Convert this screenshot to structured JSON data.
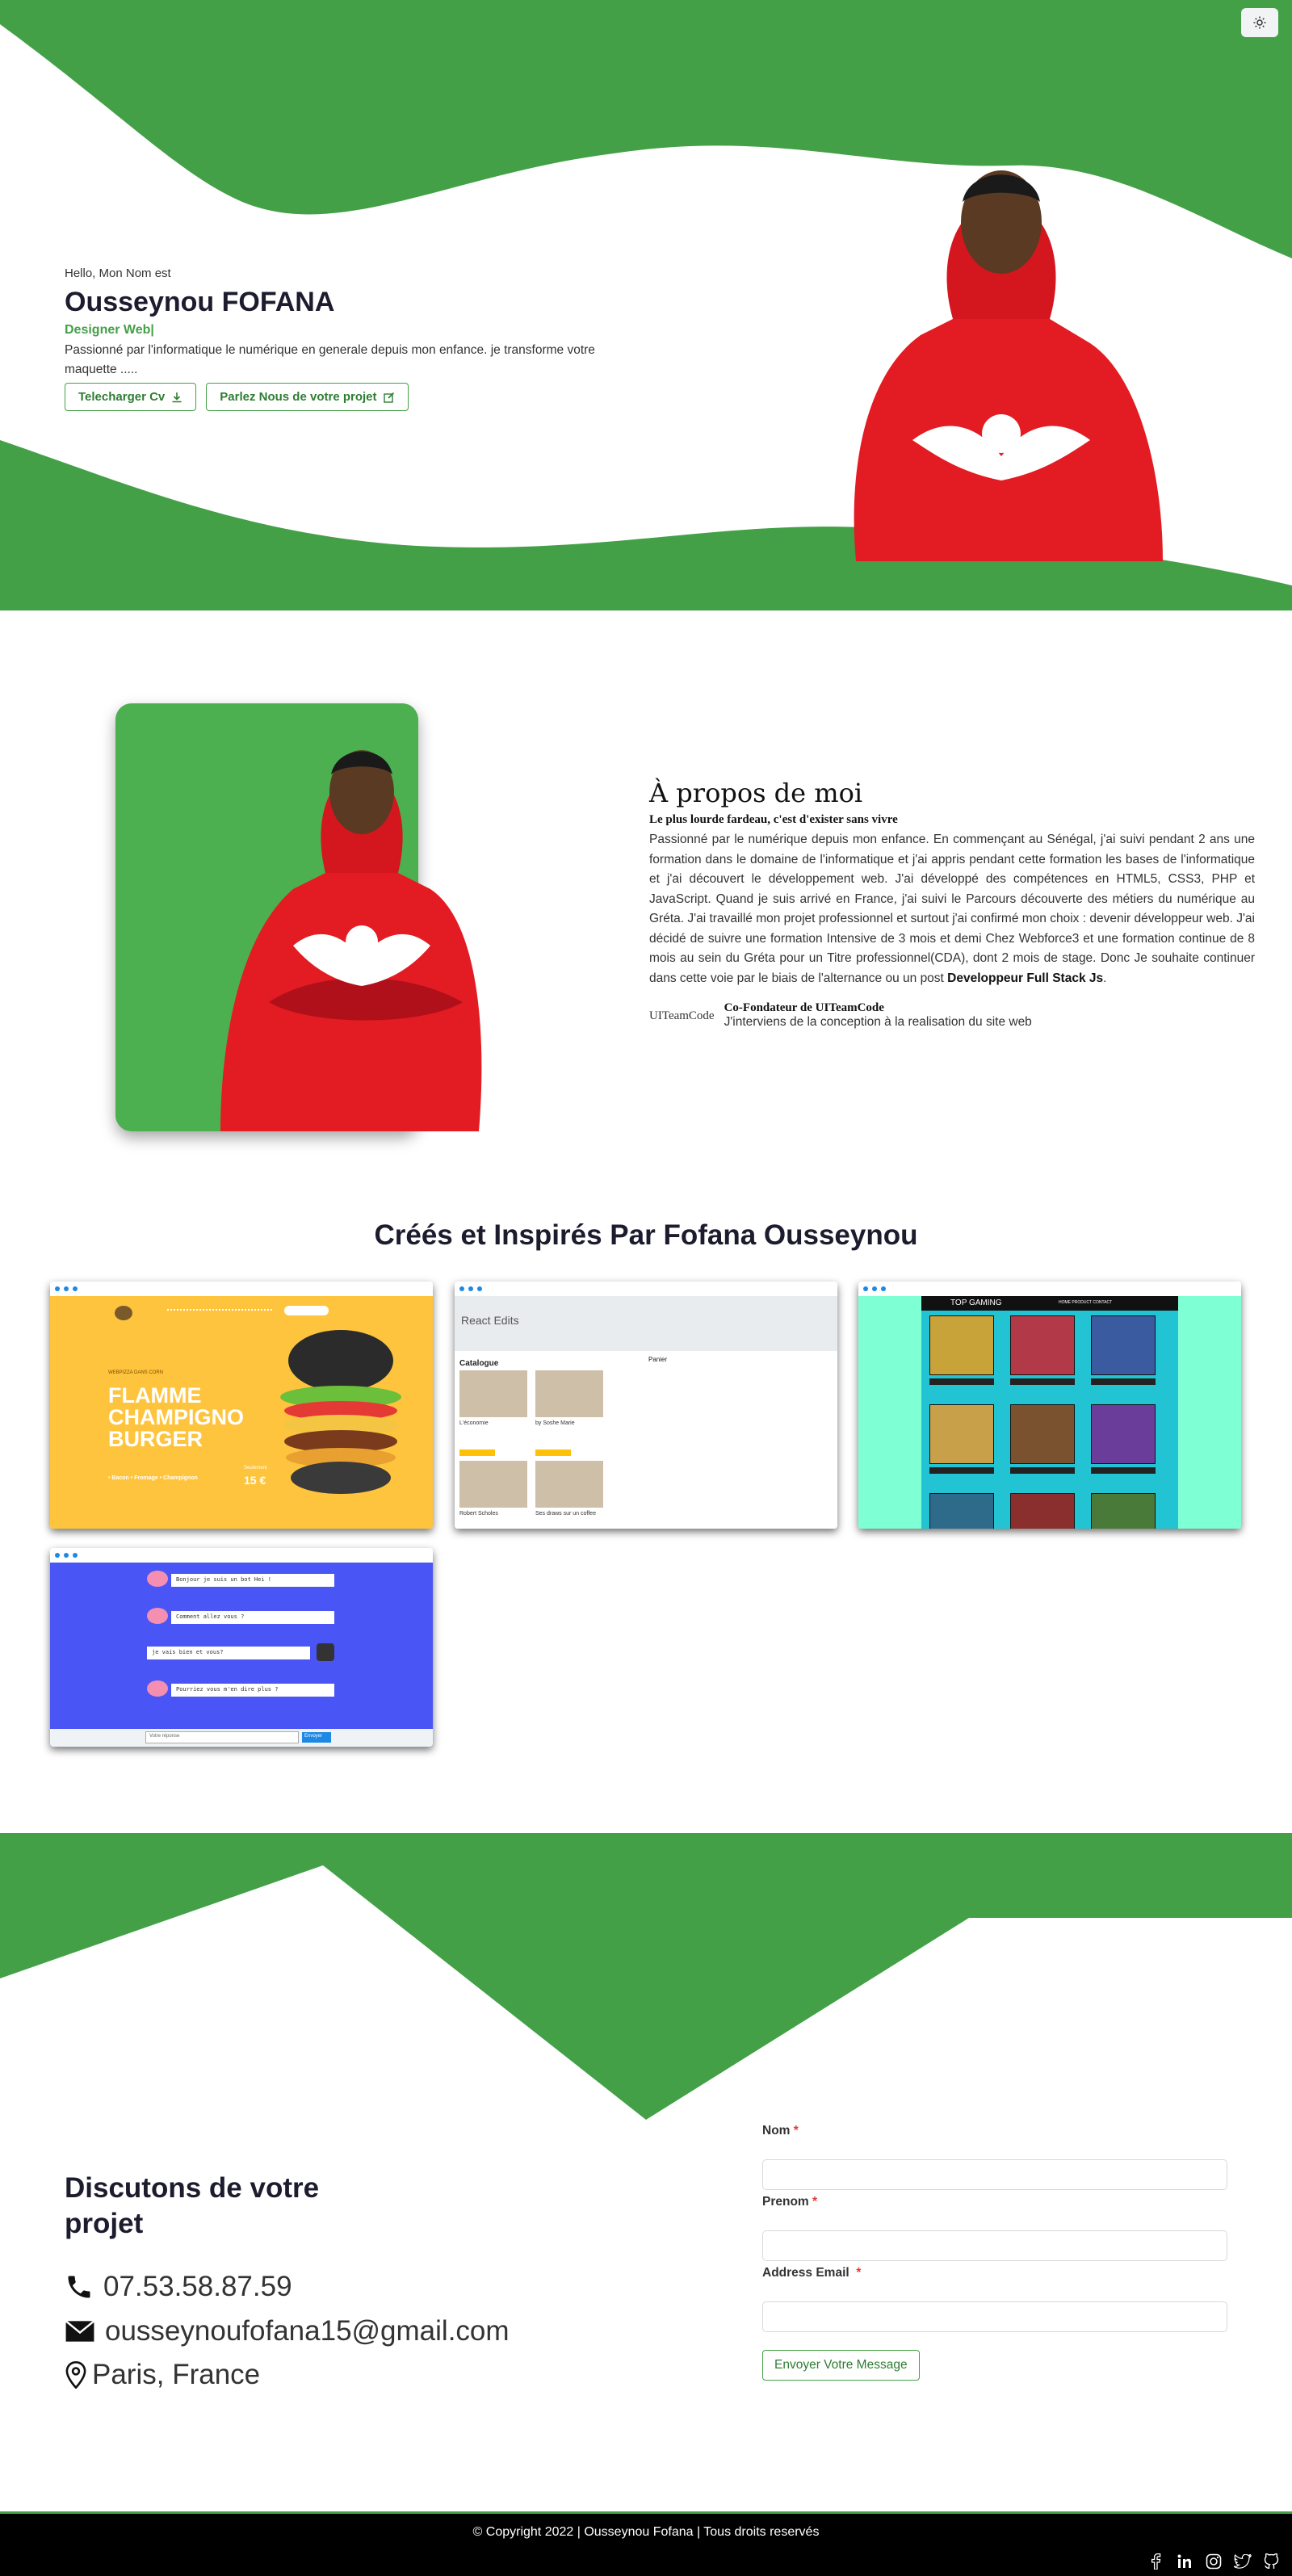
{
  "theme_toggle": {
    "icon": "sun-icon"
  },
  "hero": {
    "greeting": "Hello, Mon Nom est",
    "name": "Ousseynou FOFANA",
    "role": "Designer Web|",
    "intro": "Passionné par l'informatique le numérique en generale depuis mon enfance. je transforme votre maquette .....",
    "download_cv": "Telecharger Cv",
    "contact_project": "Parlez Nous de votre projet",
    "accent_color": "#43a047"
  },
  "about": {
    "title": "À propos de moi",
    "subtitle": "Le plus lourde fardeau, c'est d'exister sans vivre",
    "body": "Passionné par le numérique depuis mon enfance. En commençant au Sénégal, j'ai suivi pendant 2 ans une formation dans le domaine de l'informatique et j'ai appris pendant cette formation les bases de l'informatique et j'ai découvert le développement web. J'ai développé des compétences en HTML5, CSS3, PHP et JavaScript. Quand je suis arrivé en France, j'ai suivi le Parcours découverte des métiers du numérique au Gréta. J'ai travaillé mon projet professionnel et surtout j'ai confirmé mon choix : devenir développeur web. J'ai décidé de suivre une formation Intensive de 3 mois et demi Chez Webforce3 et une formation continue de 8 mois au sein du Gréta pour un Titre professionnel(CDA), dont 2 mois de stage. Donc Je souhaite continuer dans cette voie par le biais de l'alternance ou un post ",
    "body_strong": "Developpeur Full Stack Js",
    "body_end": ".",
    "cofounder_logo": "UITeamCode",
    "cofounder_title": "Co-Fondateur de UITeamCode",
    "cofounder_desc": "J'interviens de la conception à la realisation du site web"
  },
  "projects": {
    "title": "Créés et Inspirés Par Fofana Ousseynou",
    "burger": {
      "tagline": "WEBPIZZA DANS CORN",
      "headline_1": "FLAMME",
      "headline_2": "CHAMPIGNO",
      "headline_3": "BURGER",
      "features": "• Bacon   • Fromage   • Champignon",
      "price_label": "Seulement",
      "price": "15 €"
    },
    "react": {
      "title": "React Edits",
      "catalogue": "Catalogue",
      "panier": "Panier",
      "item_1": "L'économie",
      "item_2": "by Soshe Marie",
      "item_3": "Robert Scholes",
      "item_4": "Ses draws sur un coffee"
    },
    "gaming": {
      "title": "TOP GAMING",
      "nav": "HOME   PRODUCT   CONTACT"
    },
    "chat": {
      "msg_1": "Bonjour je suis un bot Hei !",
      "msg_2": "Comment allez vous ?",
      "msg_3": "je vais bien et vous?",
      "msg_4": "Pourriez vous m'en dire plus ?",
      "input_placeholder": "Votre réponse",
      "send": "Envoyer"
    }
  },
  "contact": {
    "title": "Discutons de votre projet",
    "phone": "07.53.58.87.59",
    "email": "ousseynoufofana15@gmail.com",
    "location": "Paris, France",
    "label_nom": "Nom",
    "label_prenom": "Prenom",
    "label_email": "Address Email",
    "required_mark": "*",
    "submit": "Envoyer Votre Message"
  },
  "footer": {
    "copyright": "© Copyright 2022 | Ousseynou Fofana | Tous droits reservés",
    "socials": [
      "facebook-icon",
      "linkedin-icon",
      "instagram-icon",
      "twitter-icon",
      "github-icon"
    ]
  }
}
